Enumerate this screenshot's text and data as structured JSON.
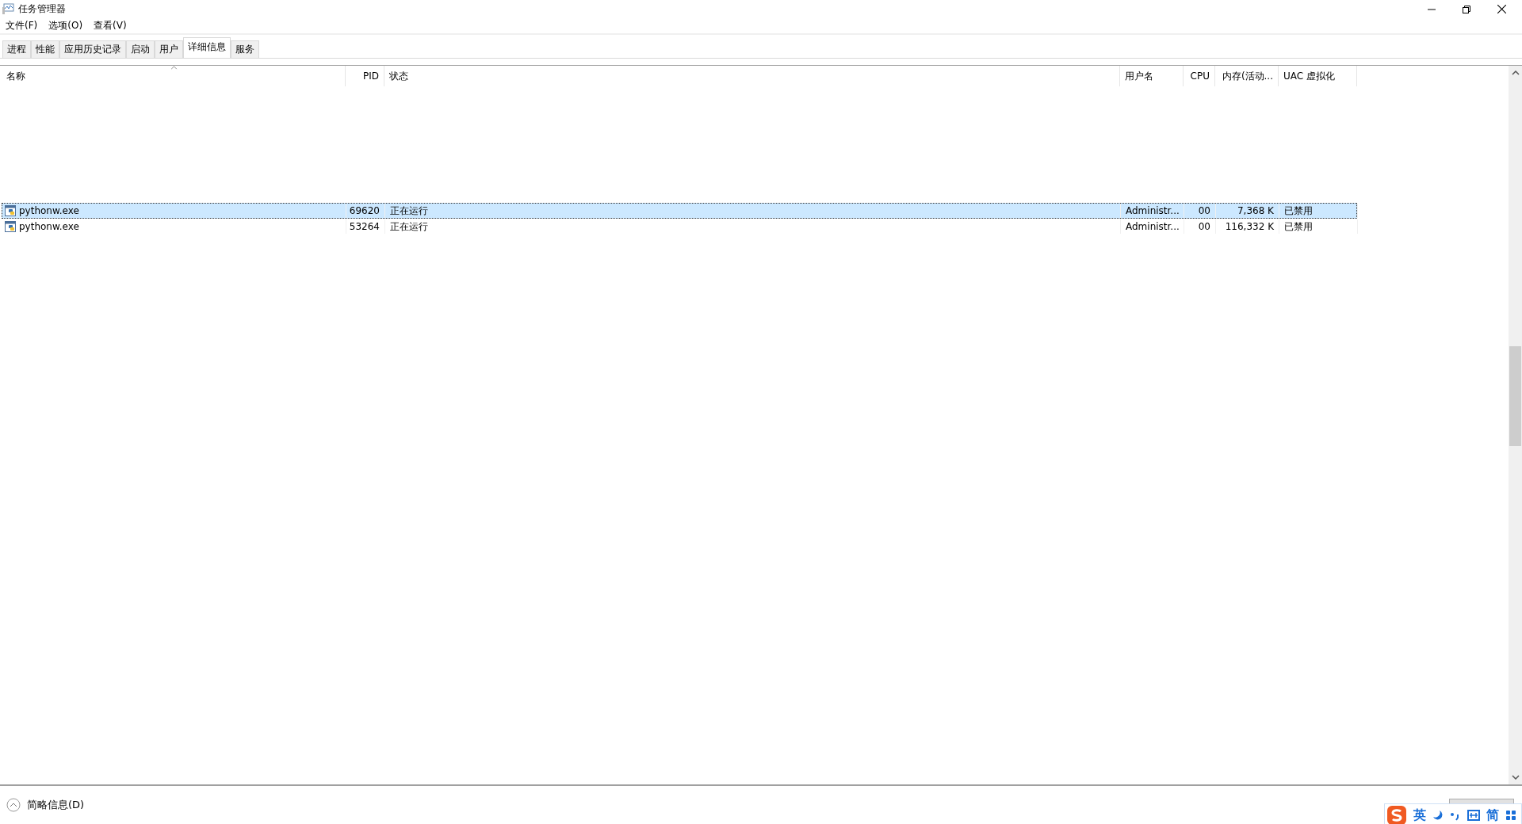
{
  "window": {
    "title": "任务管理器"
  },
  "menu": [
    "文件(F)",
    "选项(O)",
    "查看(V)"
  ],
  "tabs": [
    {
      "label": "进程",
      "selected": false
    },
    {
      "label": "性能",
      "selected": false
    },
    {
      "label": "应用历史记录",
      "selected": false
    },
    {
      "label": "启动",
      "selected": false
    },
    {
      "label": "用户",
      "selected": false
    },
    {
      "label": "详细信息",
      "selected": true
    },
    {
      "label": "服务",
      "selected": false
    }
  ],
  "table": {
    "columns": [
      {
        "label": "名称",
        "sorted": true
      },
      {
        "label": "PID",
        "sorted": false
      },
      {
        "label": "状态",
        "sorted": false
      },
      {
        "label": "用户名",
        "sorted": false
      },
      {
        "label": "CPU",
        "sorted": false
      },
      {
        "label": "内存(活动...",
        "sorted": false
      },
      {
        "label": "UAC 虚拟化",
        "sorted": false
      }
    ],
    "rows": [
      {
        "selected": true,
        "cells": [
          "pythonw.exe",
          "69620",
          "正在运行",
          "Administr...",
          "00",
          "7,368 K",
          "已禁用"
        ]
      },
      {
        "selected": false,
        "cells": [
          "pythonw.exe",
          "53264",
          "正在运行",
          "Administr...",
          "00",
          "116,332 K",
          "已禁用"
        ]
      }
    ]
  },
  "footer": {
    "details_toggle": "简略信息(D)"
  },
  "ime_toolbar": {
    "language": "英",
    "script": "简"
  }
}
